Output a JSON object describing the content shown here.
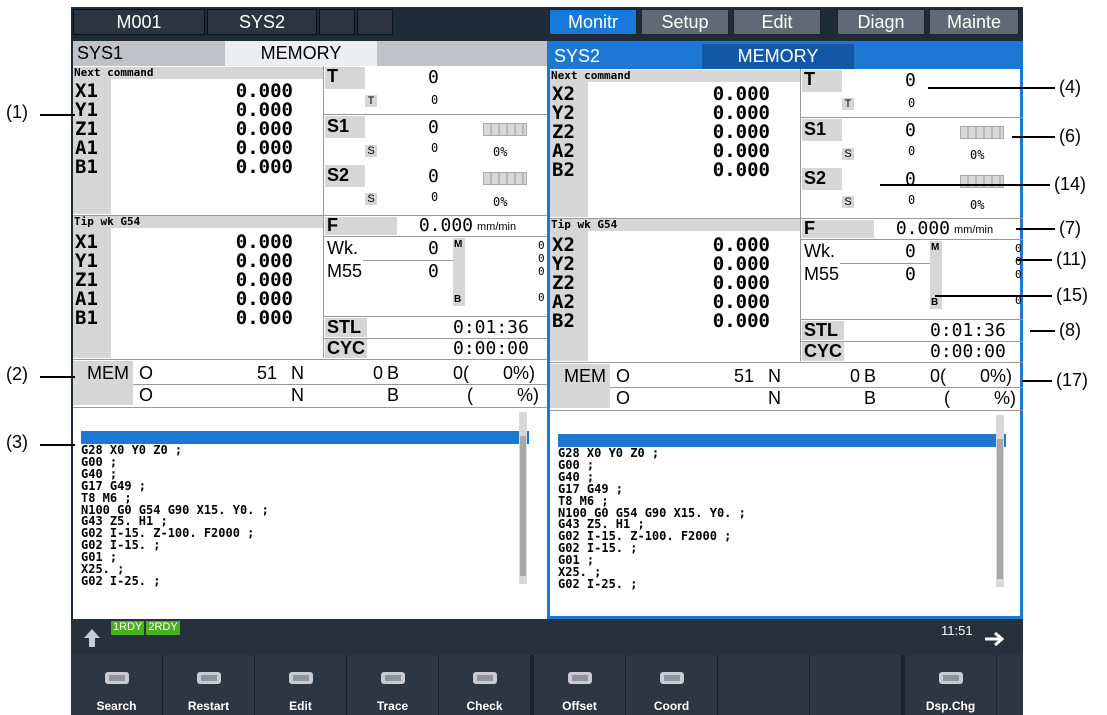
{
  "topbar": {
    "left": [
      "M001",
      "SYS2",
      "",
      ""
    ],
    "right": [
      "Monitr",
      "Setup",
      "Edit",
      "Diagn",
      "Mainte"
    ],
    "active": "Monitr"
  },
  "panels": [
    {
      "system": "SYS1",
      "mode": "MEMORY",
      "next_command_label": "Next command",
      "axes1": [
        {
          "n": "X1",
          "v": "0.000"
        },
        {
          "n": "Y1",
          "v": "0.000"
        },
        {
          "n": "Z1",
          "v": "0.000"
        },
        {
          "n": "A1",
          "v": "0.000"
        },
        {
          "n": "B1",
          "v": "0.000"
        }
      ],
      "t_label": "T",
      "t_val": "0",
      "t_sub_label": "T",
      "t_sub_val": "0",
      "s1_label": "S1",
      "s1_val": "0",
      "s1_sub_label": "S",
      "s1_sub_val": "0",
      "s1_pct": "0%",
      "s2_label": "S2",
      "s2_val": "0",
      "s2_sub_label": "S",
      "s2_sub_val": "0",
      "s2_pct": "0%",
      "tip_label": "Tip wk G54",
      "axes2": [
        {
          "n": "X1",
          "v": "0.000"
        },
        {
          "n": "Y1",
          "v": "0.000"
        },
        {
          "n": "Z1",
          "v": "0.000"
        },
        {
          "n": "A1",
          "v": "0.000"
        },
        {
          "n": "B1",
          "v": "0.000"
        }
      ],
      "f_label": "F",
      "f_val": "0.000",
      "f_unit": "mm/min",
      "wk_label": "Wk.",
      "wk_val": "0",
      "m55_label": "M55",
      "m55_val": "0",
      "m_label": "M",
      "m_vals": [
        "0",
        "0",
        "0"
      ],
      "b_label": "B",
      "b_val": "0",
      "stl_label": "STL",
      "stl_val": "0:01:36",
      "cyc_label": "CYC",
      "cyc_val": "0:00:00",
      "row1": {
        "mode": "MEM",
        "o": "O",
        "o_val": "51",
        "n": "N",
        "n_val": "0",
        "b": "B",
        "b_val": "0(",
        "pct": "0%)"
      },
      "row2": {
        "o": "O",
        "n": "N",
        "b": "B",
        "paren": "(",
        "pct": "%)"
      },
      "program": "G28 X0 Y0 Z0 ;\nG00 ;\nG40 ;\nG17 G49 ;\nT8 M6 ;\nN100 G0 G54 G90 X15. Y0. ;\nG43 Z5. H1 ;\nG02 I-15. Z-100. F2000 ;\nG02 I-15. ;\nG01 ;\nX25. ;\nG02 I-25. ;"
    },
    {
      "system": "SYS2",
      "mode": "MEMORY",
      "next_command_label": "Next command",
      "axes1": [
        {
          "n": "X2",
          "v": "0.000"
        },
        {
          "n": "Y2",
          "v": "0.000"
        },
        {
          "n": "Z2",
          "v": "0.000"
        },
        {
          "n": "A2",
          "v": "0.000"
        },
        {
          "n": "B2",
          "v": "0.000"
        }
      ],
      "t_label": "T",
      "t_val": "0",
      "t_sub_label": "T",
      "t_sub_val": "0",
      "s1_label": "S1",
      "s1_val": "0",
      "s1_sub_label": "S",
      "s1_sub_val": "0",
      "s1_pct": "0%",
      "s2_label": "S2",
      "s2_val": "0",
      "s2_sub_label": "S",
      "s2_sub_val": "0",
      "s2_pct": "0%",
      "tip_label": "Tip wk G54",
      "axes2": [
        {
          "n": "X2",
          "v": "0.000"
        },
        {
          "n": "Y2",
          "v": "0.000"
        },
        {
          "n": "Z2",
          "v": "0.000"
        },
        {
          "n": "A2",
          "v": "0.000"
        },
        {
          "n": "B2",
          "v": "0.000"
        }
      ],
      "f_label": "F",
      "f_val": "0.000",
      "f_unit": "mm/min",
      "wk_label": "Wk.",
      "wk_val": "0",
      "m55_label": "M55",
      "m55_val": "0",
      "m_label": "M",
      "m_vals": [
        "0",
        "0",
        "0"
      ],
      "b_label": "B",
      "b_val": "0",
      "stl_label": "STL",
      "stl_val": "0:01:36",
      "cyc_label": "CYC",
      "cyc_val": "0:00:00",
      "row1": {
        "mode": "MEM",
        "o": "O",
        "o_val": "51",
        "n": "N",
        "n_val": "0",
        "b": "B",
        "b_val": "0(",
        "pct": "0%)"
      },
      "row2": {
        "o": "O",
        "n": "N",
        "b": "B",
        "paren": "(",
        "pct": "%)"
      },
      "program": "G28 X0 Y0 Z0 ;\nG00 ;\nG40 ;\nG17 G49 ;\nT8 M6 ;\nN100 G0 G54 G90 X15. Y0. ;\nG43 Z5. H1 ;\nG02 I-15. Z-100. F2000 ;\nG02 I-15. ;\nG01 ;\nX25. ;\nG02 I-25. ;"
    }
  ],
  "status": {
    "rdy1": "1RDY",
    "rdy2": "2RDY",
    "time": "11:51"
  },
  "fkeys": [
    "Search",
    "Restart",
    "Edit",
    "Trace",
    "Check",
    "Offset",
    "Coord",
    "",
    "",
    "Dsp.Chg"
  ],
  "annotations": {
    "a1": "(1)",
    "a2": "(2)",
    "a3": "(3)",
    "a4": "(4)",
    "a6": "(6)",
    "a14": "(14)",
    "a7": "(7)",
    "a11": "(11)",
    "a15": "(15)",
    "a8": "(8)",
    "a17": "(17)"
  },
  "colors": {
    "active_tab": "#1879dc",
    "rdy": "#4caf1e",
    "panel_border": "#1d78d4"
  }
}
